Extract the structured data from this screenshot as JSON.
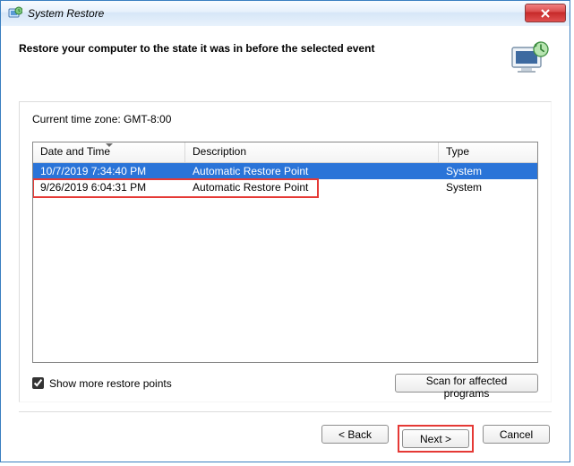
{
  "titlebar": {
    "title": "System Restore"
  },
  "heading": "Restore your computer to the state it was in before the selected event",
  "timezone_label": "Current time zone: GMT-8:00",
  "columns": {
    "datetime": "Date and Time",
    "description": "Description",
    "type": "Type"
  },
  "rows": [
    {
      "datetime": "10/7/2019 7:34:40 PM",
      "description": "Automatic Restore Point",
      "type": "System",
      "selected": true
    },
    {
      "datetime": "9/26/2019 6:04:31 PM",
      "description": "Automatic Restore Point",
      "type": "System",
      "selected": false
    }
  ],
  "checkbox": {
    "label": "Show more restore points",
    "checked": true
  },
  "buttons": {
    "scan": "Scan for affected programs",
    "back": "< Back",
    "next": "Next >",
    "cancel": "Cancel"
  }
}
